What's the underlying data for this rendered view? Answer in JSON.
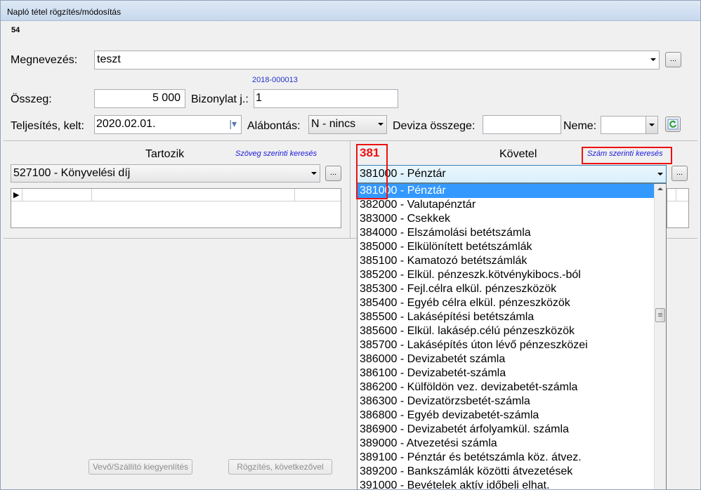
{
  "window": {
    "title": "Napló tétel rögzítés/módosítás"
  },
  "record_id": "54",
  "form": {
    "megnevezes": {
      "label": "Megnevezés:",
      "value": "teszt"
    },
    "bizonylat_code": "2018-000013",
    "osszeg": {
      "label": "Összeg:",
      "value": "5 000"
    },
    "bizonylat": {
      "label": "Bizonylat j.:",
      "value": "1"
    },
    "teljesites": {
      "label": "Teljesítés, kelt:",
      "value": "2020.02.01."
    },
    "alabontas": {
      "label": "Alábontás:",
      "value": "N - nincs"
    },
    "deviza": {
      "label": "Deviza összege:",
      "value": ""
    },
    "neme": {
      "label": "Neme:",
      "value": ""
    },
    "ellipsis": "..."
  },
  "tartozik": {
    "title": "Tartozik",
    "search_link": "Szöveg szerinti keresés",
    "account": "527100 - Könyvelési díj",
    "grid_marker": "▶"
  },
  "kovetel": {
    "title": "Követel",
    "search_link": "Szám szerinti keresés",
    "search_text": "381",
    "account": "381000 - Pénztár"
  },
  "dropdown_items": [
    "381000 - Pénztár",
    "382000 - Valutapénztár",
    "383000 - Csekkek",
    "384000 - Elszámolási betétszámla",
    "385000 - Elkülönített betétszámlák",
    "385100 - Kamatozó betétszámlák",
    "385200 - Elkül. pénzeszk.kötvénykibocs.-ból",
    "385300 - Fejl.célra elkül. pénzeszközök",
    "385400 - Egyéb célra elkül. pénzeszközök",
    "385500 - Lakásépítési betétszámla",
    "385600 - Elkül. lakásép.célú pénzeszközök",
    "385700 - Lakásépítés úton lévő pénzeszközei",
    "386000 - Devizabetét számla",
    "386100 - Devizabetét-számla",
    "386200 - Külföldön vez. devizabetét-számla",
    "386300 - Devizatörzsbetét-számla",
    "386800 - Egyéb devizabetét-számla",
    "386900 - Devizabetét árfolyamkül. számla",
    "389000 - Atvezetési számla",
    "389100 - Pénztár és betétszámla köz. átvez.",
    "389200 - Bankszámlák közötti átvezetések",
    "391000 - Bevételek aktív időbeli elhat."
  ],
  "bottom_buttons": {
    "vevo": "Vevő/Szállító kiegyenlítés",
    "rogzites": "Rögzítés, következővel"
  },
  "colors": {
    "selection": "#3399ff",
    "annotation": "#ee1111",
    "link": "#1a1adb"
  }
}
